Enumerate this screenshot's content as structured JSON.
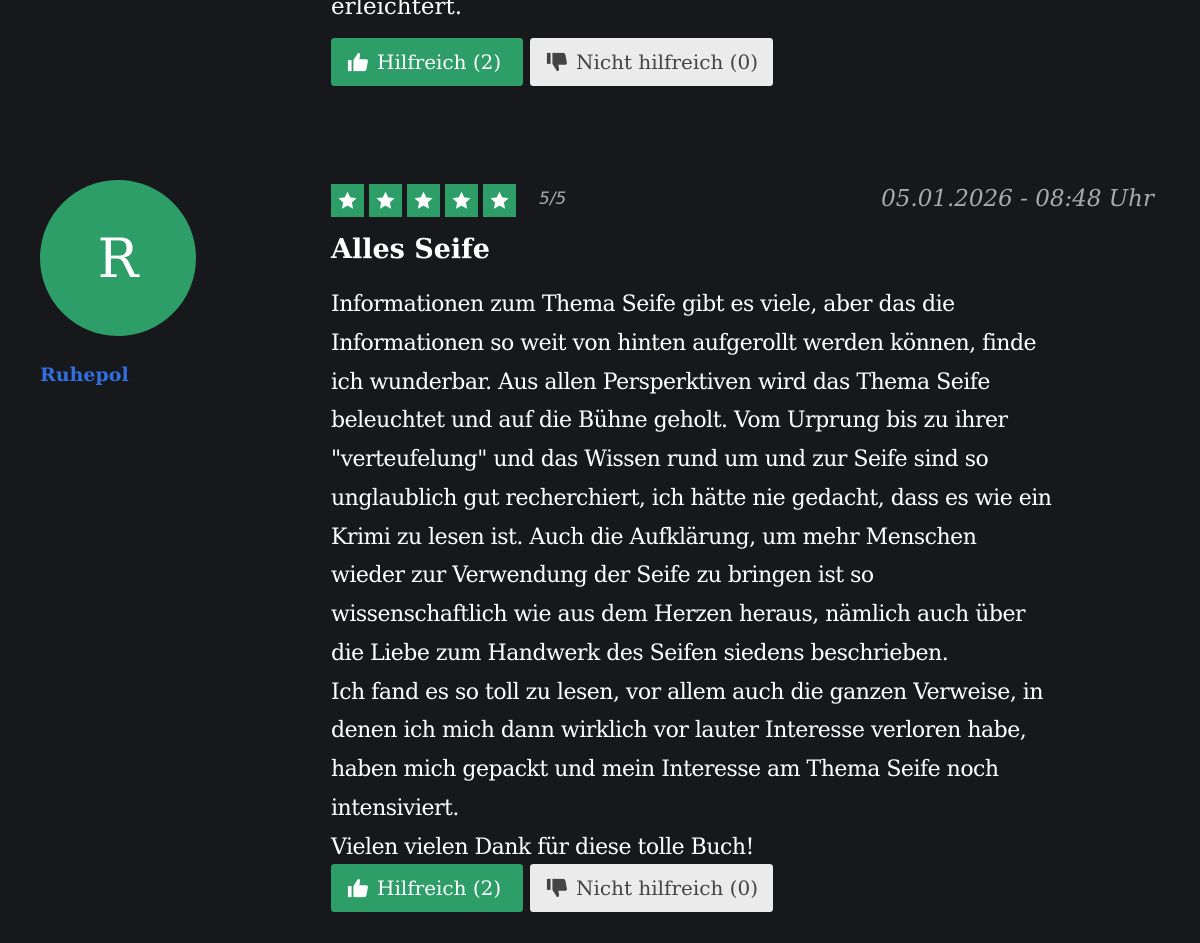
{
  "previous_review": {
    "tail_text": "erleichtert.",
    "helpful_label": "Hilfreich (2)",
    "not_helpful_label": "Nicht hilfreich (0)"
  },
  "review": {
    "author_initial": "R",
    "author_name": "Ruhepol",
    "rating": 5,
    "rating_max": 5,
    "rating_text": "5/5",
    "timestamp": "05.01.2026 - 08:48 Uhr",
    "title": "Alles Seife",
    "body_lines": [
      "Informationen zum Thema Seife gibt es viele, aber das die",
      "Informationen so weit von hinten aufgerollt werden können, finde",
      "ich wunderbar. Aus allen Persperktiven wird das Thema Seife",
      "beleuchtet und auf die Bühne geholt. Vom Urprung bis zu ihrer",
      "\"verteufelung\" und das Wissen rund um und zur Seife sind so",
      "unglaublich gut recherchiert, ich hätte nie gedacht, dass es wie ein",
      "Krimi zu lesen ist. Auch die Aufklärung, um mehr Menschen",
      "wieder zur Verwendung der Seife zu bringen ist so",
      "wissenschaftlich wie aus dem Herzen heraus, nämlich auch über",
      "die Liebe zum Handwerk des Seifen siedens beschrieben.",
      "Ich fand es so toll zu lesen, vor allem auch die ganzen Verweise, in",
      "denen ich mich dann wirklich vor lauter Interesse verloren habe,",
      "haben mich gepackt und mein Interesse am Thema Seife noch",
      "intensiviert.",
      "Vielen vielen Dank für diese tolle Buch!"
    ],
    "helpful_label": "Hilfreich (2)",
    "not_helpful_label": "Nicht hilfreich (0)"
  },
  "colors": {
    "background": "#17181c",
    "accent_green": "#2e9e68",
    "author_link": "#2f6fe0",
    "muted_text": "#a9a9ad",
    "neutral_button": "#ebebeb"
  },
  "icons": {
    "helpful": "thumbs-up-icon",
    "not_helpful": "thumbs-down-icon",
    "rating": "star-icon"
  }
}
